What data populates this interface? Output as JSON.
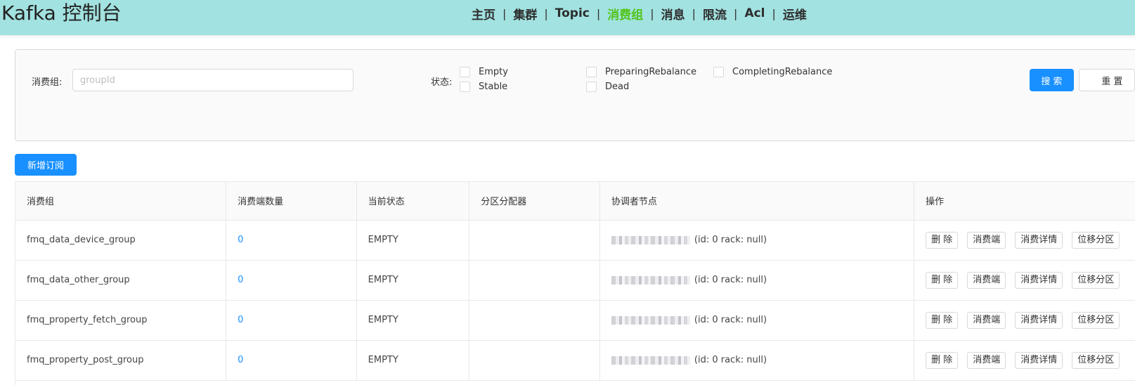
{
  "header": {
    "title": "Kafka 控制台",
    "nav": [
      {
        "label": "主页",
        "active": false
      },
      {
        "label": "集群",
        "active": false
      },
      {
        "label": "Topic",
        "active": false
      },
      {
        "label": "消费组",
        "active": true
      },
      {
        "label": "消息",
        "active": false
      },
      {
        "label": "限流",
        "active": false
      },
      {
        "label": "Acl",
        "active": false
      },
      {
        "label": "运维",
        "active": false
      }
    ],
    "separator": "|"
  },
  "search": {
    "group_label": "消费组:",
    "group_placeholder": "groupId",
    "group_value": "",
    "status_label": "状态:",
    "statuses": [
      {
        "label": "Empty",
        "checked": false
      },
      {
        "label": "Stable",
        "checked": false
      },
      {
        "label": "PreparingRebalance",
        "checked": false
      },
      {
        "label": "Dead",
        "checked": false
      },
      {
        "label": "CompletingRebalance",
        "checked": false
      }
    ],
    "search_button": "搜 索",
    "reset_button": "重 置"
  },
  "add_button": "新增订阅",
  "table": {
    "columns": [
      "消费组",
      "消费端数量",
      "当前状态",
      "分区分配器",
      "协调者节点",
      "操作"
    ],
    "rows": [
      {
        "group": "fmq_data_device_group",
        "count": "0",
        "state": "EMPTY",
        "assignor": "",
        "coordinator": "(id: 0 rack: null)"
      },
      {
        "group": "fmq_data_other_group",
        "count": "0",
        "state": "EMPTY",
        "assignor": "",
        "coordinator": "(id: 0 rack: null)"
      },
      {
        "group": "fmq_property_fetch_group",
        "count": "0",
        "state": "EMPTY",
        "assignor": "",
        "coordinator": "(id: 0 rack: null)"
      },
      {
        "group": "fmq_property_post_group",
        "count": "0",
        "state": "EMPTY",
        "assignor": "",
        "coordinator": "(id: 0 rack: null)"
      }
    ],
    "actions": [
      "删 除",
      "消费端",
      "消费详情",
      "位移分区"
    ]
  },
  "colors": {
    "header_bg": "#a2e2e0",
    "active_nav": "#52c41a",
    "primary": "#1890ff"
  }
}
